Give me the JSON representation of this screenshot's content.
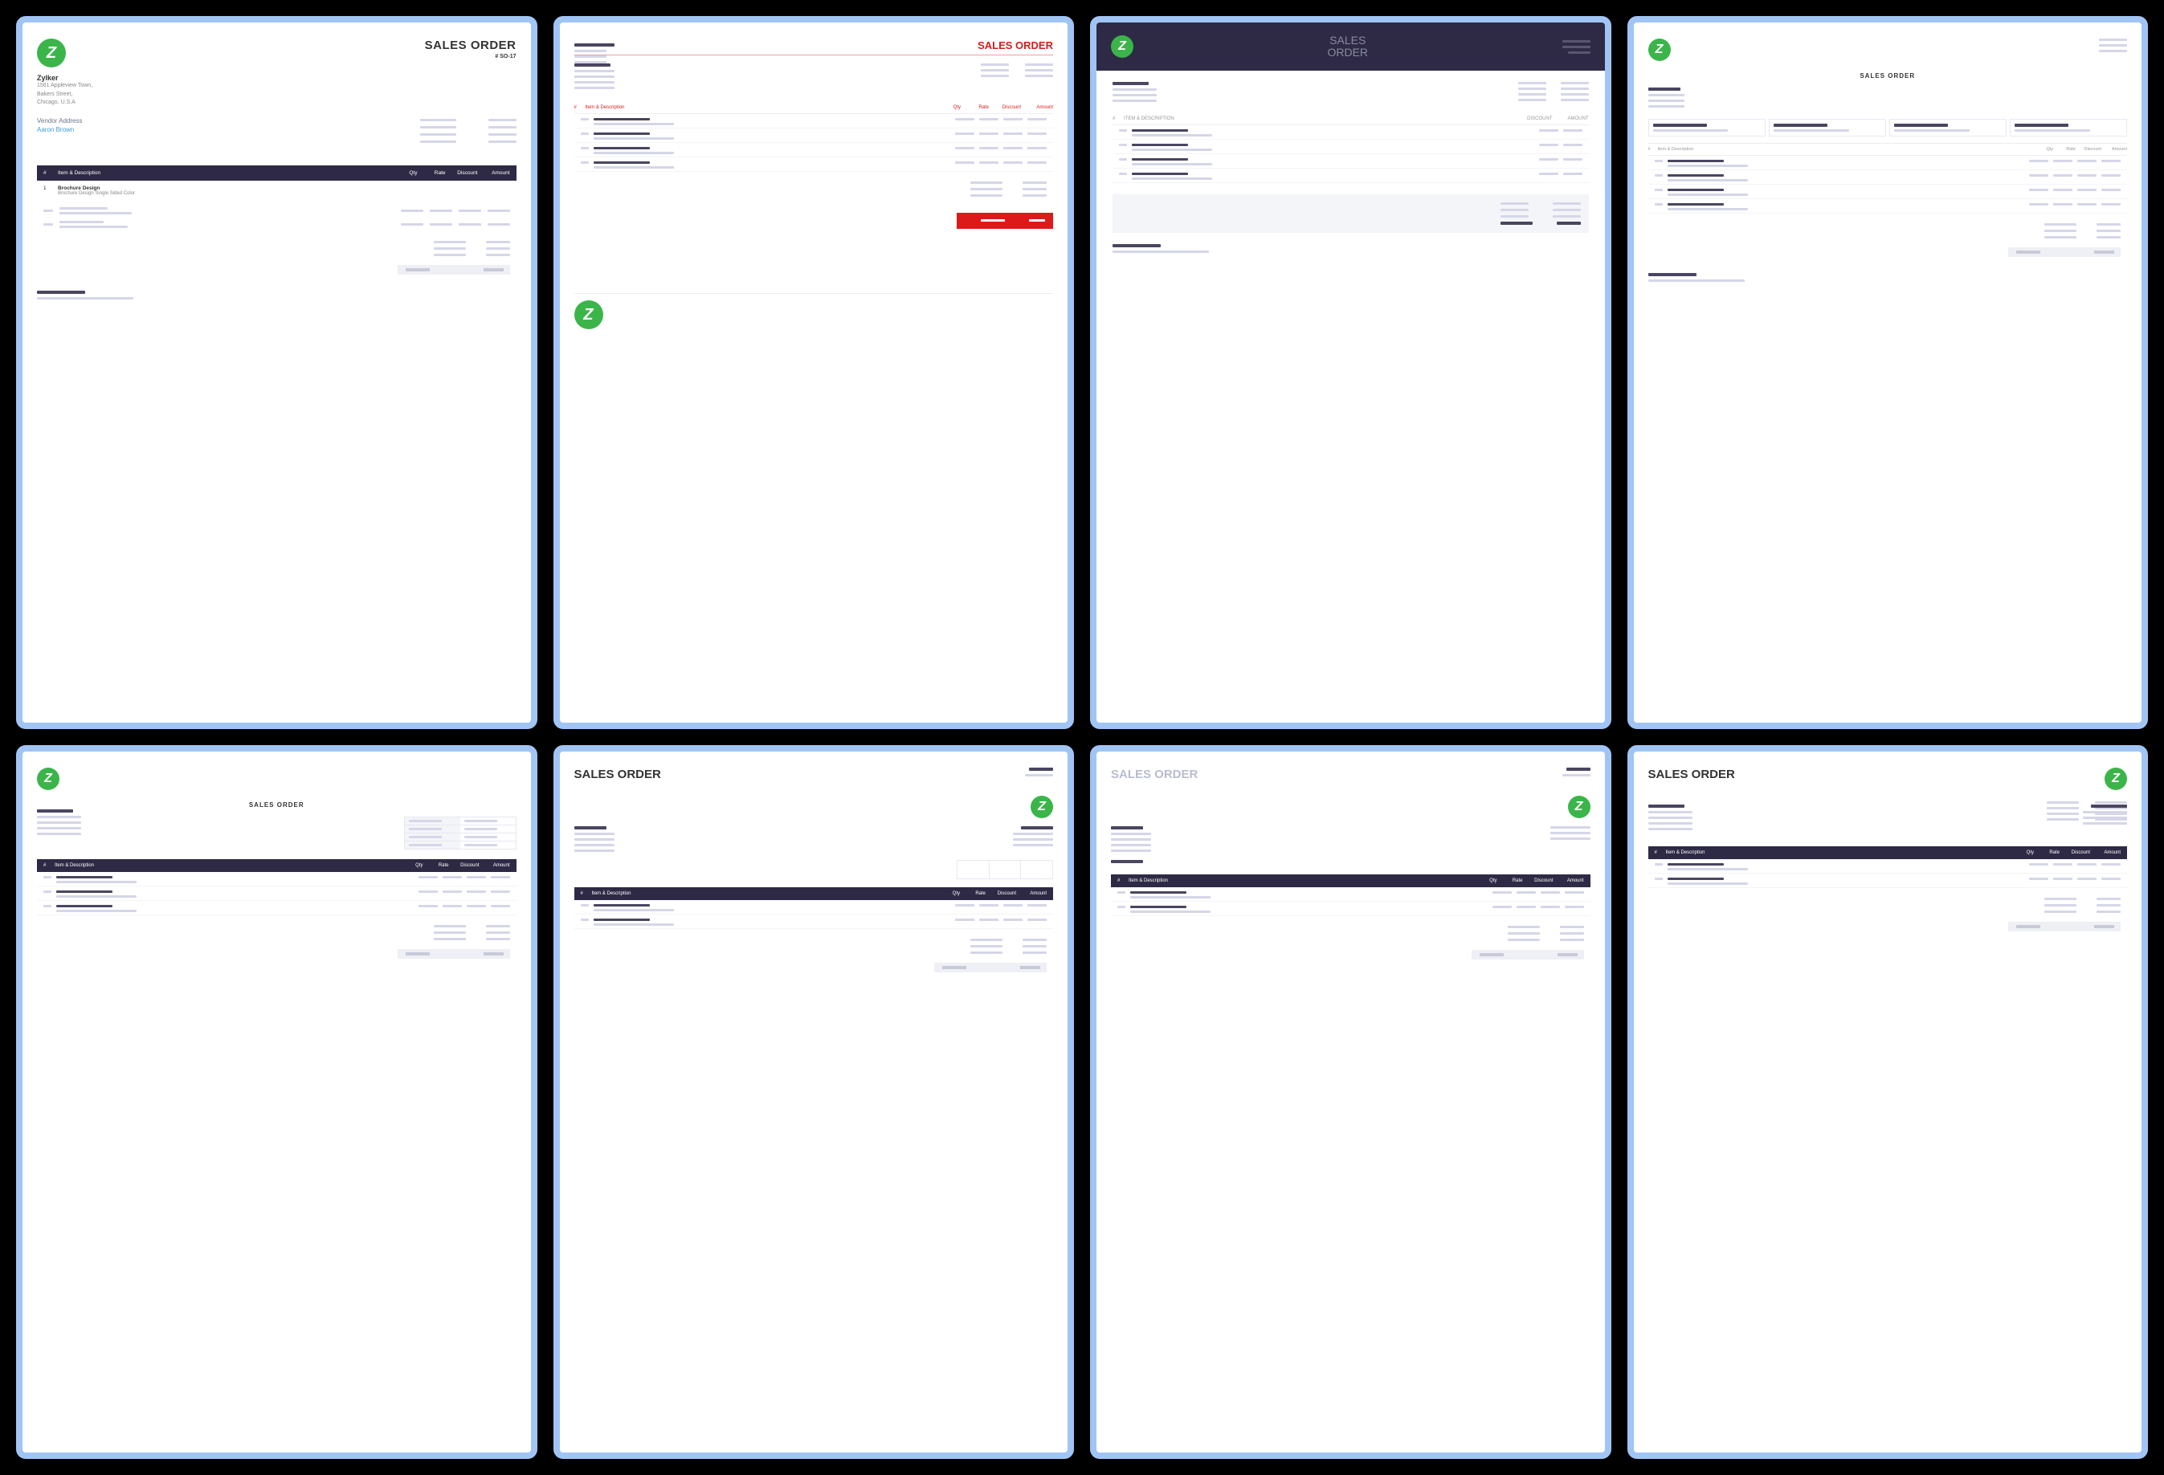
{
  "common": {
    "logo_letter": "Z",
    "sales_order": "SALES ORDER",
    "headers": {
      "num": "#",
      "item": "Item & Description",
      "item_caps": "ITEM & DESCRIPTION",
      "qty": "Qty",
      "rate": "Rate",
      "discount": "Discount",
      "discount_caps": "DISCOUNT",
      "amount": "Amount",
      "amount_caps": "AMOUNT"
    }
  },
  "t1": {
    "title": "SALES ORDER",
    "order_no": "# SO-17",
    "company": "Zylker",
    "addr1": "1561 Appleview Town,",
    "addr2": "Bakers Street,",
    "addr3": "Chicago, U.S.A",
    "vendor_label": "Vendor Address",
    "vendor_name": "Aaron Brown",
    "row1_num": "1",
    "row1_item": "Brochure Design",
    "row1_desc": "Brochure Design Single Sided Color"
  },
  "t2": {
    "title": "SALES ORDER"
  },
  "t3": {
    "title": "SALES ORDER"
  },
  "t4": {
    "title": "SALES ORDER"
  },
  "t5": {
    "title": "SALES ORDER"
  },
  "t6": {
    "title": "SALES ORDER"
  },
  "t7": {
    "title": "SALES ORDER"
  },
  "t8": {
    "title": "SALES ORDER"
  }
}
